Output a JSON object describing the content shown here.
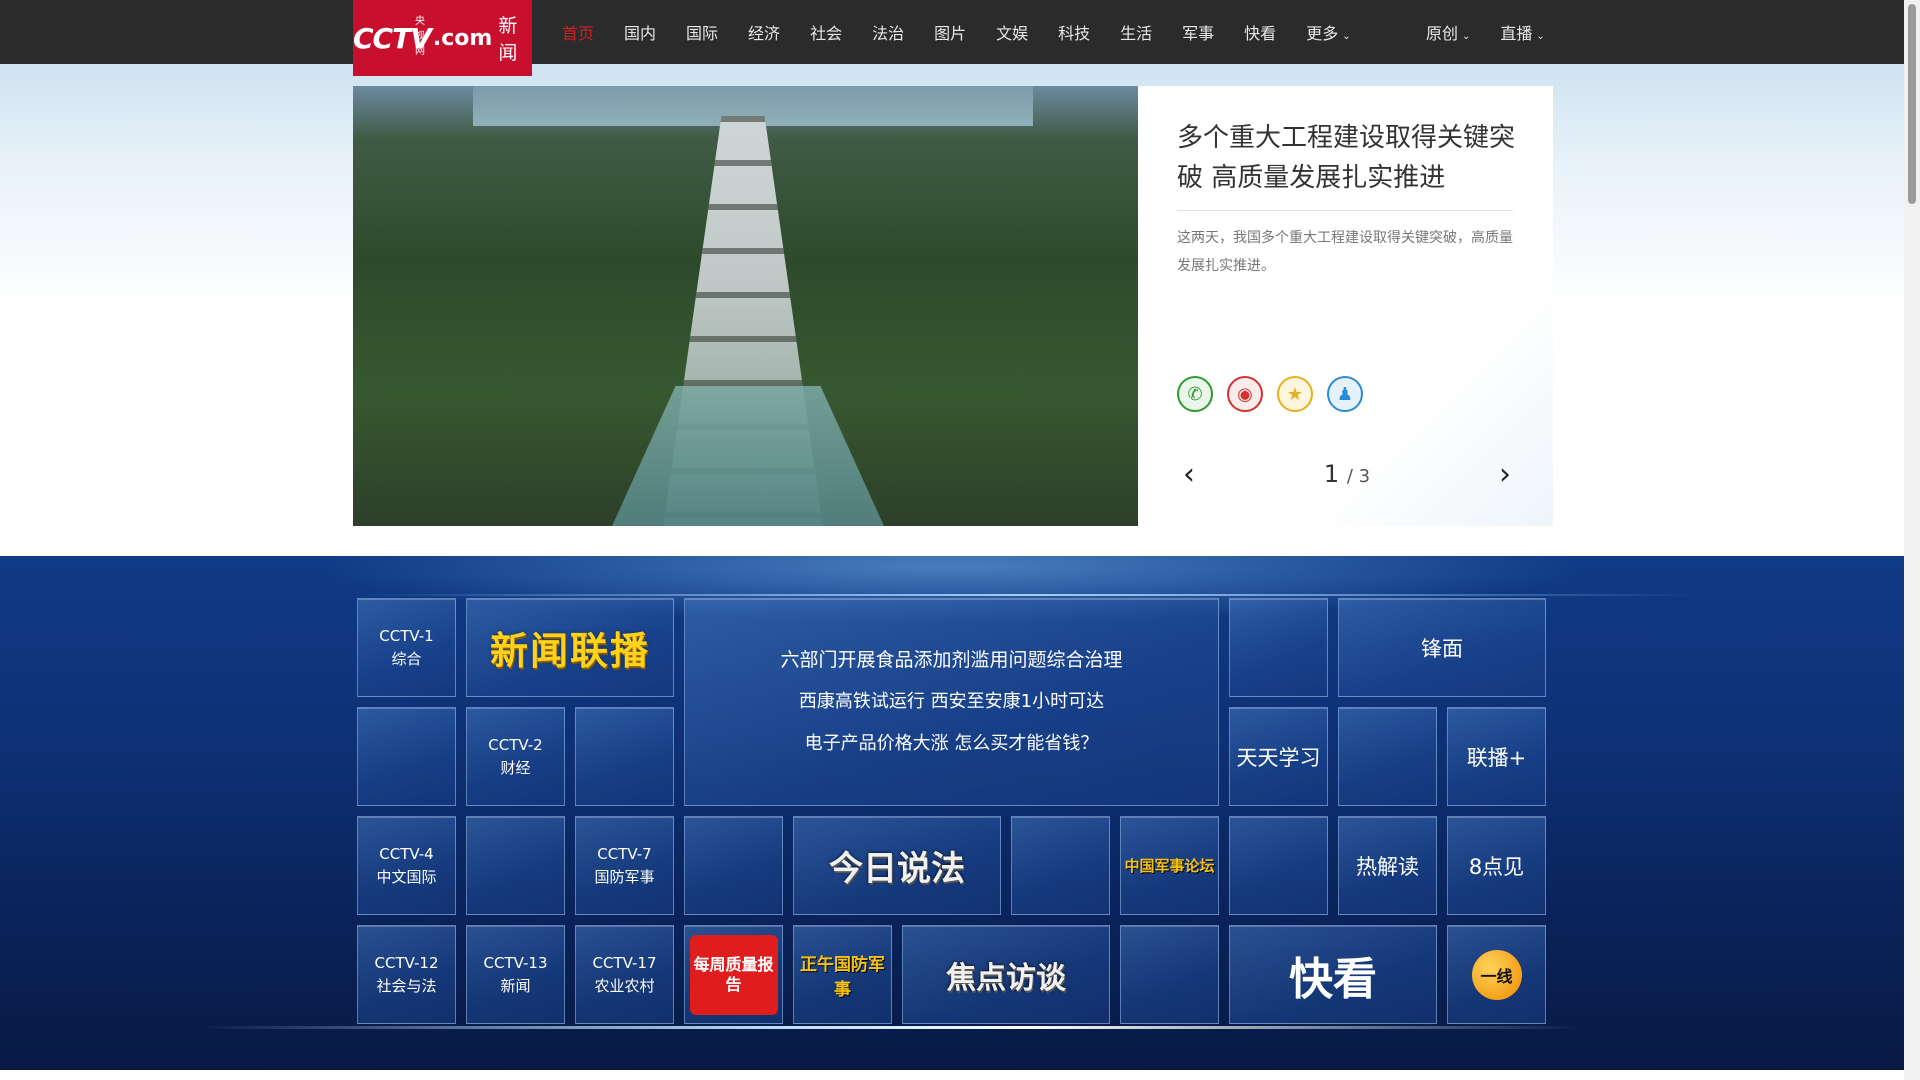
{
  "brand": {
    "logo_cctv": "CCTV",
    "logo_small": "央视网",
    "logo_com": ".com",
    "logo_news": "新闻",
    "accent_red": "#c8102e"
  },
  "nav": {
    "items": [
      "首页",
      "国内",
      "国际",
      "经济",
      "社会",
      "法治",
      "图片",
      "文娱",
      "科技",
      "生活",
      "军事",
      "快看"
    ],
    "more": "更多",
    "original": "原创",
    "live": "直播"
  },
  "hero": {
    "title": "多个重大工程建设取得关键突破 高质量发展扎实推进",
    "description": "这两天，我国多个重大工程建设取得关键突破，高质量发展扎实推进。",
    "current_page": "1",
    "page_sep": "/",
    "total_pages": "3",
    "share_icons": [
      "wechat-icon",
      "weibo-icon",
      "favorite-icon",
      "qq-icon"
    ]
  },
  "grid": {
    "cctv1": [
      "CCTV-1",
      "综合"
    ],
    "cctv2": [
      "CCTV-2",
      "财经"
    ],
    "cctv4": [
      "CCTV-4",
      "中文国际"
    ],
    "cctv7": [
      "CCTV-7",
      "国防军事"
    ],
    "cctv12": [
      "CCTV-12",
      "社会与法"
    ],
    "cctv13": [
      "CCTV-13",
      "新闻"
    ],
    "cctv17": [
      "CCTV-17",
      "农业农村"
    ],
    "xwlb": "新闻联播",
    "headlines": [
      "六部门开展食品添加剂滥用问题综合治理",
      "西康高铁试运行 西安至安康1小时可达",
      "电子产品价格大涨 怎么买才能省钱？"
    ],
    "fengmian": "锋面",
    "tiantian": "天天学习",
    "lianbo_plus": "联播+",
    "jinri": "今日说法",
    "junshi_forum": "中国军事论坛",
    "rejiedu": "热解读",
    "badian": "8点见",
    "baozhi": "每周质量报告",
    "zhengwu": "正午国防军事",
    "jiaodian": "焦点访谈",
    "kuaikan": "快看",
    "yixian": "一线"
  }
}
